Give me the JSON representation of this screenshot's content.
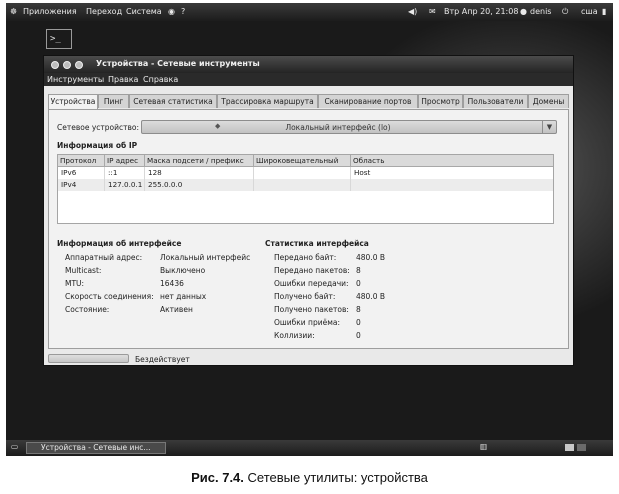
{
  "top_panel": {
    "applications": "Приложения",
    "places": "Переход",
    "system": "Система",
    "datetime": "Втр Апр 20, 21:08",
    "user": "denis",
    "keyboard_layout": "сша"
  },
  "window": {
    "title": "Устройства - Сетевые инструменты",
    "menu": [
      "Инструменты",
      "Правка",
      "Справка"
    ],
    "tabs": [
      "Устройства",
      "Пинг",
      "Сетевая статистика",
      "Трассировка маршрута",
      "Сканирование портов",
      "Просмотр",
      "Пользователи",
      "Домены"
    ],
    "active_tab": 0,
    "device_label": "Сетевое устройство:",
    "device_value": "Локальный интерфейс (lo)",
    "ip_section_title": "Информация об IP",
    "ip_table": {
      "headers": [
        "Протокол",
        "IP адрес",
        "Маска подсети / префикс",
        "Широковещательный",
        "Область"
      ],
      "rows": [
        [
          "IPv6",
          "::1",
          "128",
          "",
          "Host"
        ],
        [
          "IPv4",
          "127.0.0.1",
          "255.0.0.0",
          "",
          ""
        ]
      ]
    },
    "interface_info": {
      "title": "Информация об интерфейсе",
      "rows": [
        {
          "label": "Аппаратный адрес:",
          "value": "Локальный интерфейс"
        },
        {
          "label": "Multicast:",
          "value": "Выключено"
        },
        {
          "label": "MTU:",
          "value": "16436"
        },
        {
          "label": "Скорость соединения:",
          "value": "нет данных"
        },
        {
          "label": "Состояние:",
          "value": "Активен"
        }
      ]
    },
    "interface_stats": {
      "title": "Статистика интерфейса",
      "rows": [
        {
          "label": "Передано байт:",
          "value": "480.0 B"
        },
        {
          "label": "Передано пакетов:",
          "value": "8"
        },
        {
          "label": "Ошибки передачи:",
          "value": "0"
        },
        {
          "label": "Получено байт:",
          "value": "480.0 B"
        },
        {
          "label": "Получено пакетов:",
          "value": "8"
        },
        {
          "label": "Ошибки приёма:",
          "value": "0"
        },
        {
          "label": "Коллизии:",
          "value": "0"
        }
      ]
    },
    "status_text": "Бездействует"
  },
  "taskbar": {
    "task_label": "Устройства - Сетевые инс..."
  },
  "caption": {
    "prefix": "Рис. 7.4.",
    "text": "Сетевые утилиты: устройства"
  }
}
